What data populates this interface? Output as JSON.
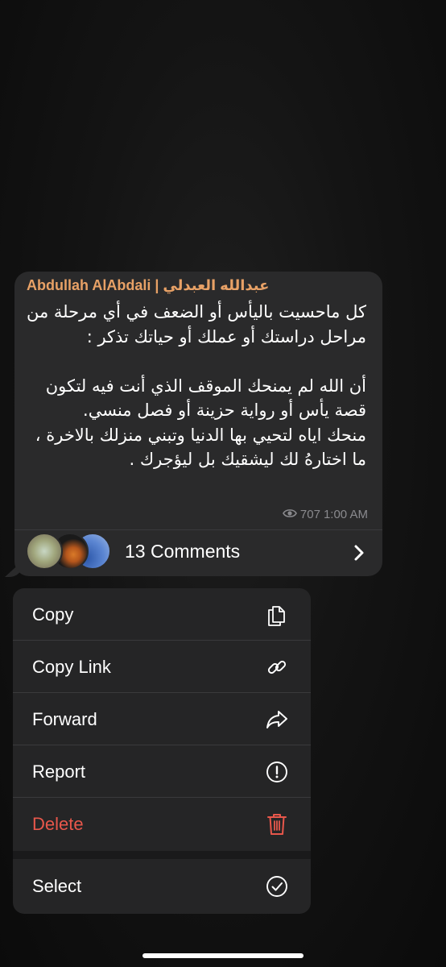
{
  "message": {
    "sender": "Abdullah AlAbdali | عبدالله العبدلي",
    "text": "كل ماحسيت باليأس أو الضعف في أي مرحلة من مراحل دراستك أو عملك أو حياتك تذكر :\n\nأن الله لم يمنحك الموقف الذي أنت فيه لتكون قصة يأس أو رواية حزينة أو فصل منسي.\nمنحك اياه لتحيي بها الدنيا وتبني منزلك بالاخرة ، ما اختارهُ لك ليشقيك بل ليؤجرك .",
    "views": "707",
    "time": "1:00 AM",
    "view_icon": "eye-icon"
  },
  "comments": {
    "label": "13 Comments",
    "avatars": [
      "avatar-1",
      "avatar-2",
      "avatar-3"
    ],
    "chevron_icon": "chevron-right-icon"
  },
  "menu": {
    "items": [
      {
        "label": "Copy",
        "icon": "copy-icon"
      },
      {
        "label": "Copy Link",
        "icon": "link-icon"
      },
      {
        "label": "Forward",
        "icon": "forward-icon"
      },
      {
        "label": "Report",
        "icon": "exclamation-circle-icon"
      },
      {
        "label": "Delete",
        "icon": "trash-icon",
        "color": "#e8574b"
      },
      {
        "label": "Select",
        "icon": "checkmark-circle-icon"
      }
    ]
  },
  "colors": {
    "sender": "#e8a166",
    "bubble": "#2a2a2b",
    "menu": "#252526",
    "destructive": "#e8574b"
  }
}
